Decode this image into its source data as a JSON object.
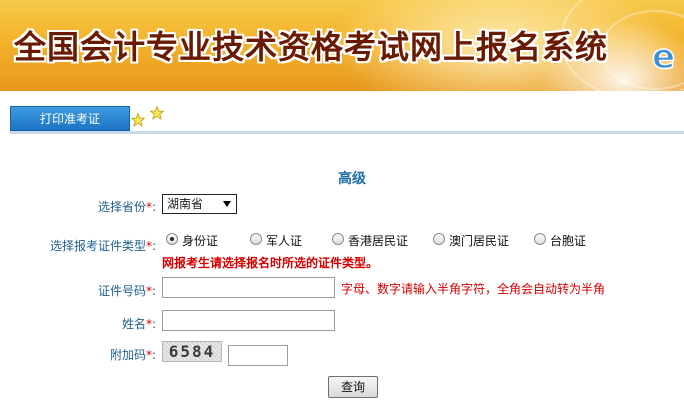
{
  "banner": {
    "title": "全国会计专业技术资格考试网上报名系统"
  },
  "tabs": [
    {
      "label": "打印准考证"
    }
  ],
  "form": {
    "title": "高级",
    "province": {
      "label": "选择省份",
      "required_mark": "*",
      "selected": "湖南省"
    },
    "id_type": {
      "label": "选择报考证件类型",
      "required_mark": "*",
      "options": [
        "身份证",
        "军人证",
        "香港居民证",
        "澳门居民证",
        "台胞证"
      ],
      "selected_index": 0,
      "notice": "网报考生请选择报名时所选的证件类型。"
    },
    "id_number": {
      "label": "证件号码",
      "required_mark": "*",
      "value": "",
      "hint": "字母、数字请输入半角字符，全角会自动转为半角"
    },
    "name": {
      "label": "姓名",
      "required_mark": "*",
      "value": ""
    },
    "captcha": {
      "label": "附加码",
      "required_mark": "*",
      "image_text": "6584",
      "value": ""
    },
    "submit_label": "查询"
  },
  "colors": {
    "label": "#1f5f8f",
    "required": "#e00000",
    "tab": "#1c74c4",
    "banner_text": "#6a1a00"
  }
}
